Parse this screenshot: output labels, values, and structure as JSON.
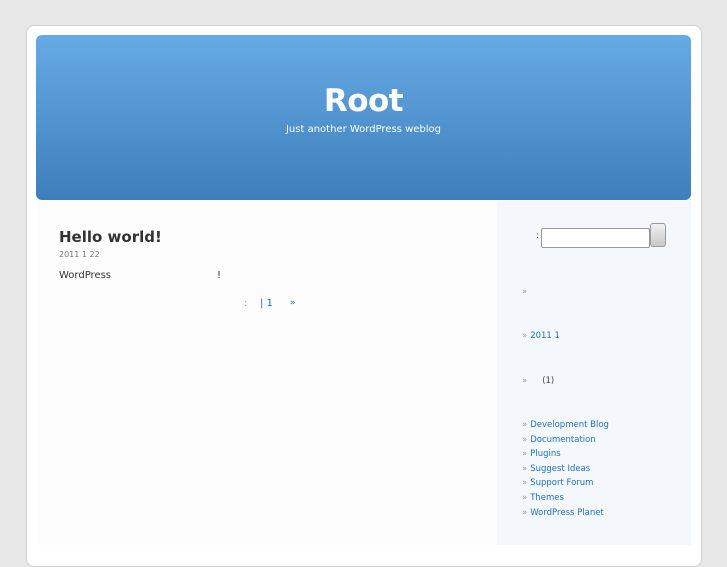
{
  "header": {
    "title": "Root",
    "description": "Just another WordPress weblog"
  },
  "post": {
    "title": "Hello world!",
    "date": "2011 1 22",
    "body": "WordPress",
    "body_end": "!",
    "meta_sep": ":",
    "comments": "| 1",
    "more": "»"
  },
  "sidebar": {
    "search_label": ":",
    "pages_bullet": "»",
    "archive": "2011 1",
    "category_count": "(1)",
    "links": [
      "Development Blog",
      "Documentation",
      "Plugins",
      "Suggest Ideas",
      "Support Forum",
      "Themes",
      "WordPress Planet"
    ],
    "bullet": "»"
  }
}
